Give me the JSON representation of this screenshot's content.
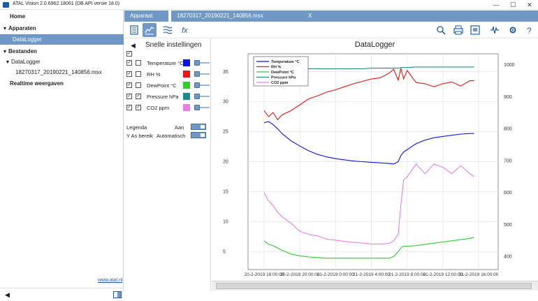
{
  "window": {
    "title": "ATAL Vision 2.0.6962.18061 (DB API versie 18.0)",
    "minimize": "—",
    "maximize": "☐",
    "close": "✕"
  },
  "sidebar": {
    "items": [
      {
        "label": "Home"
      },
      {
        "label": "Apparaten"
      },
      {
        "label": "DataLogger"
      },
      {
        "label": "Bestanden"
      },
      {
        "label": "DataLogger"
      },
      {
        "label": "18270317_20190221_140856.msx"
      },
      {
        "label": "Realtime weergaven"
      }
    ],
    "link": "www.atal.nl"
  },
  "tabs": {
    "apparaat": "Apparaat",
    "file": "18270317_20190221_140856.msx",
    "close": "X"
  },
  "settings": {
    "title": "Snelle instellingen",
    "rows": [
      {
        "label": "Temperature °C",
        "color": "#0a14e6",
        "checked": true
      },
      {
        "label": "RH %",
        "color": "#f21414",
        "checked": true
      },
      {
        "label": "DewPoint °C",
        "color": "#2ecc2e",
        "checked": true
      },
      {
        "label": "Pressure hPa",
        "color": "#1a8c8c",
        "checked": true
      },
      {
        "label": "CO2 ppm",
        "color": "#e67ee6",
        "checked": true
      }
    ],
    "legend_label": "Legenda",
    "legend_value": "Aan",
    "yaxis_label": "Y As bereik",
    "yaxis_value": "Automatisch"
  },
  "chart_data": {
    "type": "line",
    "title": "DataLogger",
    "xlabel": "",
    "ylabel": "",
    "x_ticks": [
      "20-2-2019 16:00:00",
      "20-2-2019 20:00:00",
      "21-2-2019 0:00:00",
      "21-2-2019 4:00:00",
      "21-2-2019 8:00:00",
      "21-2-2019 12:00:00",
      "21-2-2019 16:00:00"
    ],
    "y_left_ticks": [
      5,
      10,
      15,
      20,
      25,
      30,
      35
    ],
    "y_left_range": [
      2,
      38
    ],
    "y_right_ticks": [
      400,
      500,
      600,
      700,
      800,
      900,
      1000
    ],
    "y_right_range": [
      360,
      1035
    ],
    "legend": "top-left",
    "grid": true,
    "x_hours": [
      0,
      0.5,
      1,
      1.5,
      2,
      3,
      4,
      5,
      6,
      7,
      8,
      9,
      10,
      11,
      12,
      13,
      14,
      14.5,
      15,
      15.3,
      15.6,
      16,
      17,
      18,
      19,
      20,
      21,
      22,
      23,
      23.5
    ],
    "series": [
      {
        "name": "Temperature °C",
        "axis": "left",
        "color": "#0a14e6",
        "values": [
          26.5,
          26.7,
          26.2,
          25.5,
          24.7,
          23.5,
          22.6,
          21.8,
          21.2,
          20.8,
          20.5,
          20.3,
          20.1,
          20.0,
          19.9,
          19.8,
          19.7,
          19.6,
          20.0,
          21.0,
          21.6,
          22.0,
          23.0,
          23.6,
          24.0,
          24.2,
          24.4,
          24.6,
          24.7,
          24.7
        ]
      },
      {
        "name": "RH %",
        "axis": "left",
        "color": "#f21414",
        "values": [
          28.5,
          27.5,
          28.2,
          27.0,
          27.8,
          28.5,
          29.5,
          30.5,
          31.0,
          31.6,
          32.0,
          32.5,
          33.0,
          33.4,
          33.8,
          34.0,
          34.8,
          35.4,
          33.6,
          35.6,
          33.8,
          35.2,
          33.2,
          33.0,
          32.5,
          33.0,
          33.3,
          32.6,
          33.5,
          33.5
        ]
      },
      {
        "name": "DewPoint °C",
        "axis": "left",
        "color": "#2ecc2e",
        "values": [
          6.8,
          6.2,
          6.0,
          5.6,
          5.2,
          4.6,
          4.3,
          4.1,
          4.0,
          3.9,
          3.9,
          3.9,
          3.9,
          3.9,
          3.9,
          3.9,
          3.9,
          4.2,
          5.0,
          5.6,
          5.9,
          5.9,
          6.0,
          6.2,
          6.4,
          6.6,
          6.8,
          7.0,
          7.2,
          7.4
        ]
      },
      {
        "name": "Pressure hPa",
        "axis": "left",
        "color": "#1a8c8c",
        "values": [
          35.5,
          35.5,
          35.5,
          35.5,
          35.5,
          35.5,
          35.5,
          35.5,
          35.5,
          35.5,
          35.5,
          35.5,
          35.5,
          35.5,
          35.6,
          35.6,
          35.6,
          35.6,
          35.6,
          35.7,
          35.7,
          35.7,
          35.8,
          35.8,
          35.8,
          35.8,
          35.8,
          35.8,
          35.8,
          35.8
        ]
      },
      {
        "name": "CO2 ppm",
        "axis": "right",
        "color": "#e67ee6",
        "values": [
          600,
          575,
          560,
          540,
          525,
          505,
          480,
          470,
          465,
          455,
          452,
          448,
          445,
          443,
          440,
          440,
          442,
          450,
          470,
          560,
          640,
          650,
          690,
          660,
          690,
          680,
          660,
          685,
          660,
          650
        ]
      }
    ]
  }
}
